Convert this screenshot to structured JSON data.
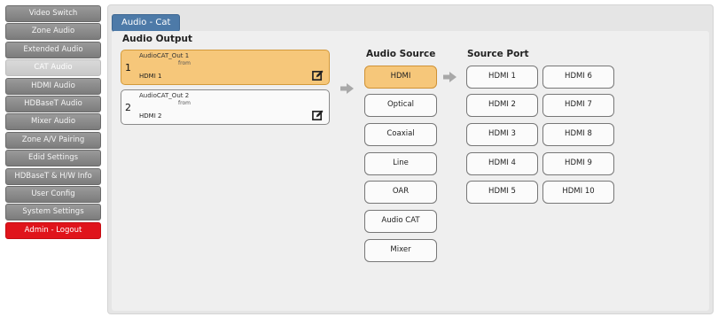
{
  "sidebar": {
    "items": [
      {
        "label": "Video Switch",
        "active": false
      },
      {
        "label": "Zone Audio",
        "active": false
      },
      {
        "label": "Extended Audio",
        "active": false
      },
      {
        "label": "CAT Audio",
        "active": true
      },
      {
        "label": "HDMI Audio",
        "active": false
      },
      {
        "label": "HDBaseT Audio",
        "active": false
      },
      {
        "label": "Mixer Audio",
        "active": false
      },
      {
        "label": "Zone A/V Pairing",
        "active": false
      },
      {
        "label": "Edid Settings",
        "active": false
      },
      {
        "label": "HDBaseT & H/W Info",
        "active": false
      },
      {
        "label": "User Config",
        "active": false
      },
      {
        "label": "System Settings",
        "active": false
      }
    ],
    "logout_label": "Admin - Logout"
  },
  "main": {
    "tab_label": "Audio - Cat",
    "audio_output": {
      "heading": "Audio Output",
      "outputs": [
        {
          "num": "1",
          "name": "AudioCAT_Out 1",
          "from": "from",
          "port": "HDMI 1",
          "selected": true
        },
        {
          "num": "2",
          "name": "AudioCAT_Out 2",
          "from": "from",
          "port": "HDMI 2",
          "selected": false
        }
      ]
    },
    "audio_source": {
      "heading": "Audio Source",
      "options": [
        "HDMI",
        "Optical",
        "Coaxial",
        "Line",
        "OAR",
        "Audio CAT",
        "Mixer"
      ],
      "selected": "HDMI"
    },
    "source_port": {
      "heading": "Source Port",
      "ports": [
        "HDMI 1",
        "HDMI 2",
        "HDMI 3",
        "HDMI 4",
        "HDMI 5",
        "HDMI 6",
        "HDMI 7",
        "HDMI 8",
        "HDMI 9",
        "HDMI 10"
      ]
    }
  },
  "colors": {
    "accent_selected": "#f6c77a",
    "tab_blue": "#4d7aa8",
    "logout_red": "#e0141b",
    "sidebar_gray": "#8a8a8a"
  },
  "icons": {
    "edit": "edit-icon",
    "arrow": "arrow-right-icon"
  }
}
